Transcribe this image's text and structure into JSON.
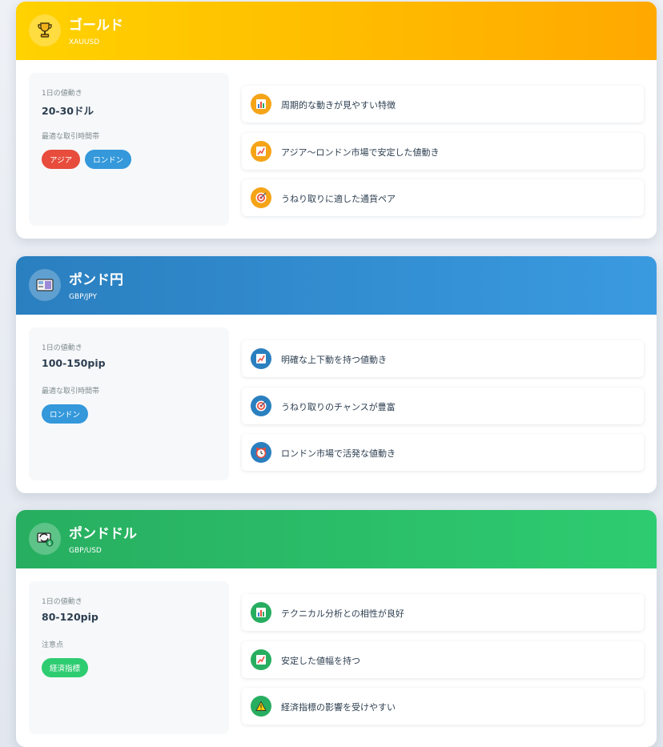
{
  "cards": [
    {
      "title": "ゴールド",
      "symbol": "XAUUSD",
      "icon": "trophy-icon",
      "accent": "#ffb000",
      "info": {
        "range_label": "1日の値動き",
        "range_value": "20-30ドル",
        "secondary_label": "最適な取引時間帯",
        "badges": [
          "アジア",
          "ロンドン"
        ]
      },
      "features": [
        {
          "icon": "bar-chart-icon",
          "text": "周期的な動きが見やすい特徴"
        },
        {
          "icon": "trend-chart-icon",
          "text": "アジア～ロンドン市場で安定した値動き"
        },
        {
          "icon": "target-icon",
          "text": "うねり取りに適した通貨ペア"
        }
      ]
    },
    {
      "title": "ポンド円",
      "symbol": "GBP/JPY",
      "icon": "banknote-icon",
      "accent": "#2a7fbf",
      "info": {
        "range_label": "1日の値動き",
        "range_value": "100-150pip",
        "secondary_label": "最適な取引時間帯",
        "badges": [
          "ロンドン"
        ]
      },
      "features": [
        {
          "icon": "trend-chart-icon",
          "text": "明確な上下動を持つ値動き"
        },
        {
          "icon": "target-icon",
          "text": "うねり取りのチャンスが豊富"
        },
        {
          "icon": "alarm-clock-icon",
          "text": "ロンドン市場で活発な値動き"
        }
      ]
    },
    {
      "title": "ポンドドル",
      "symbol": "GBP/USD",
      "icon": "currency-exchange-icon",
      "accent": "#27ae60",
      "info": {
        "range_label": "1日の値動き",
        "range_value": "80-120pip",
        "secondary_label": "注意点",
        "badges": [
          "経済指標"
        ]
      },
      "features": [
        {
          "icon": "bar-chart-icon",
          "text": "テクニカル分析との相性が良好"
        },
        {
          "icon": "trend-chart-icon",
          "text": "安定した値幅を持つ"
        },
        {
          "icon": "warning-icon",
          "text": "経済指標の影響を受けやすい"
        }
      ]
    }
  ]
}
